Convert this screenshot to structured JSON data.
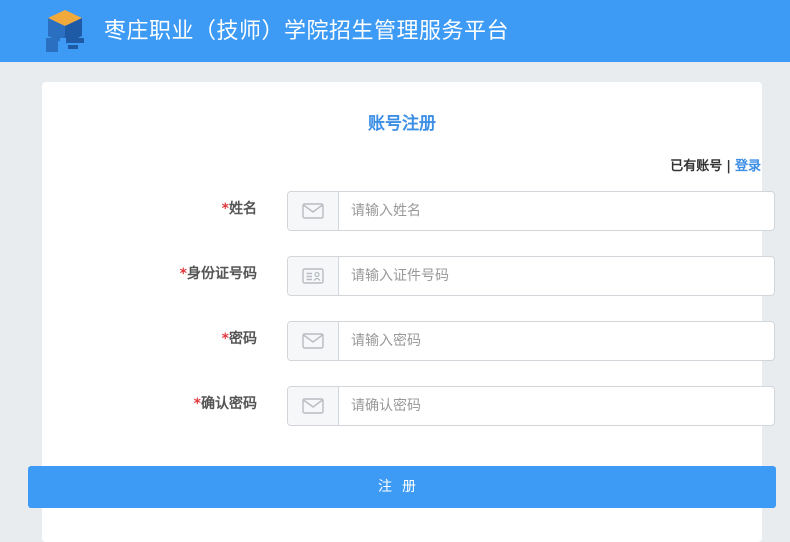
{
  "header": {
    "title": "枣庄职业（技师）学院招生管理服务平台"
  },
  "form": {
    "title": "账号注册",
    "has_account_text": "已有账号",
    "separator": "|",
    "login_link": "登录",
    "required_mark": "*",
    "fields": [
      {
        "label": "姓名",
        "placeholder": "请输入姓名",
        "icon": "envelope-icon"
      },
      {
        "label": "身份证号码",
        "placeholder": "请输入证件号码",
        "icon": "id-card-icon"
      },
      {
        "label": "密码",
        "placeholder": "请输入密码",
        "icon": "envelope-icon"
      },
      {
        "label": "确认密码",
        "placeholder": "请确认密码",
        "icon": "envelope-icon"
      }
    ],
    "submit_label": "注册"
  },
  "colors": {
    "header": "#3d9bf5",
    "accent": "#3d8fe6",
    "required": "#e0393e",
    "page_bg": "#e9ecef"
  }
}
